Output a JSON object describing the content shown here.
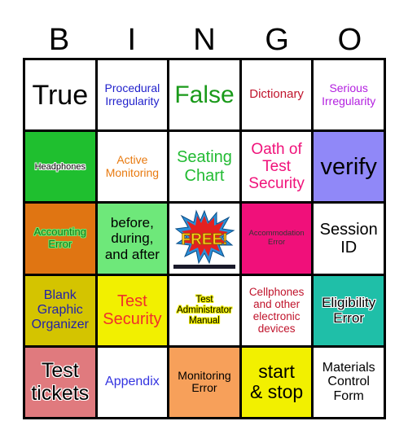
{
  "header": {
    "letters": [
      "B",
      "I",
      "N",
      "G",
      "O"
    ]
  },
  "board": {
    "cells": [
      {
        "text": "True",
        "color": "#000000",
        "bg": "#ffffff"
      },
      {
        "text": "Procedural\nIrregularity",
        "color": "#2222cc",
        "bg": "#ffffff"
      },
      {
        "text": "False",
        "color": "#1a9a1a",
        "bg": "#ffffff"
      },
      {
        "text": "Dictionary",
        "color": "#c0142c",
        "bg": "#ffffff"
      },
      {
        "text": "Serious\nIrregularity",
        "color": "#b320e0",
        "bg": "#ffffff"
      },
      {
        "text": "Headphones",
        "color": "#000000",
        "bg": "#1fbf2f"
      },
      {
        "text": "Active\nMonitoring",
        "color": "#e87a10",
        "bg": "#ffffff"
      },
      {
        "text": "Seating\nChart",
        "color": "#22bb33",
        "bg": "#ffffff"
      },
      {
        "text": "Oath of\nTest\nSecurity",
        "color": "#f0127a",
        "bg": "#ffffff"
      },
      {
        "text": "verify",
        "color": "#000000",
        "bg": "#9088f8"
      },
      {
        "text": "Accounting\nError",
        "color": "#1a7a1a",
        "bg": "#e07512"
      },
      {
        "text": "before,\nduring,\nand after",
        "color": "#000000",
        "bg": "#6ee87a"
      },
      {
        "text": "FREE!",
        "color": "#ffd21a",
        "bg": "#ffffff",
        "free": true
      },
      {
        "text": "Accommodation\nError",
        "color": "#333333",
        "bg": "#f0107a"
      },
      {
        "text": "Session\nID",
        "color": "#000000",
        "bg": "#ffffff"
      },
      {
        "text": "Blank\nGraphic\nOrganizer",
        "color": "#2222aa",
        "bg": "#d4c400"
      },
      {
        "text": "Test\nSecurity",
        "color": "#f0302a",
        "bg": "#f2f000"
      },
      {
        "text": "Test\nAdministrator\nManual",
        "color": "#000000",
        "bg": "#ffffff"
      },
      {
        "text": "Cellphones\nand other\nelectronic\ndevices",
        "color": "#c0142c",
        "bg": "#ffffff"
      },
      {
        "text": "Eligibility\nError",
        "color": "#000000",
        "bg": "#1fbfa8"
      },
      {
        "text": "Test\ntickets",
        "color": "#000000",
        "bg": "#e07a7e"
      },
      {
        "text": "Appendix",
        "color": "#3333e0",
        "bg": "#ffffff"
      },
      {
        "text": "Monitoring\nError",
        "color": "#000000",
        "bg": "#f7a05a"
      },
      {
        "text": "start\n& stop",
        "color": "#000000",
        "bg": "#f2f000"
      },
      {
        "text": "Materials\nControl\nForm",
        "color": "#000000",
        "bg": "#ffffff"
      }
    ]
  }
}
